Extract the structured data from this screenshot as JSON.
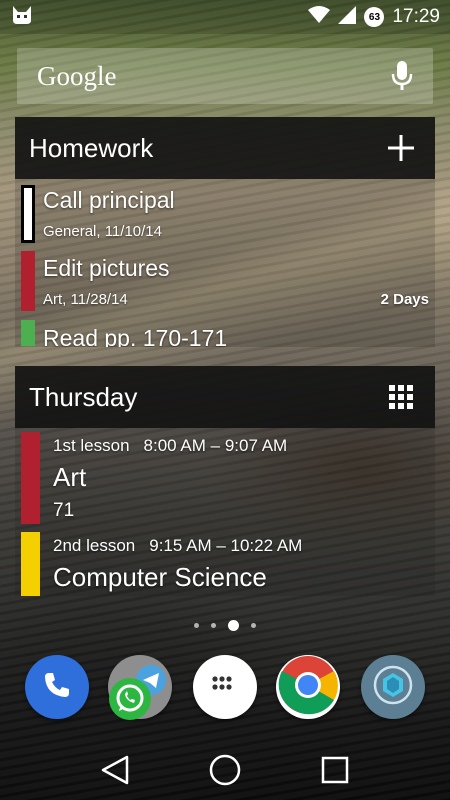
{
  "status_bar": {
    "time": "17:29",
    "battery_level": "63",
    "icons": [
      "cat-face-icon",
      "wifi-icon",
      "signal-icon",
      "battery-icon"
    ]
  },
  "search": {
    "logo_text": "Google",
    "icon": "mic-icon"
  },
  "homework": {
    "title": "Homework",
    "action_icon": "plus-icon",
    "items": [
      {
        "title": "Call principal",
        "subtitle": "General, 11/10/14",
        "due": "",
        "color": "#ffffff",
        "border": "#000000"
      },
      {
        "title": "Edit pictures",
        "subtitle": "Art, 11/28/14",
        "due": "2 Days",
        "color": "#b0202e"
      },
      {
        "title": "Read pp. 170-171",
        "subtitle": "",
        "due": "",
        "color": "#4caf50"
      }
    ]
  },
  "timetable": {
    "title": "Thursday",
    "action_icon": "grid-icon",
    "lessons": [
      {
        "lesson": "1st lesson",
        "time": "8:00 AM – 9:07 AM",
        "subject": "Art",
        "room": "71",
        "color": "#b0202e"
      },
      {
        "lesson": "2nd lesson",
        "time": "9:15 AM – 10:22 AM",
        "subject": "Computer Science",
        "room": "",
        "color": "#f5d000"
      }
    ]
  },
  "pager": {
    "pages": 4,
    "active_index": 2
  },
  "dock": [
    {
      "name": "phone",
      "icon": "phone-icon",
      "bg": "#2f6fdc"
    },
    {
      "name": "messaging-folder",
      "icon": "whatsapp-icon",
      "bg": "#9a9a9a"
    },
    {
      "name": "app-drawer",
      "icon": "app-drawer-icon",
      "bg": "#ffffff"
    },
    {
      "name": "chrome",
      "icon": "chrome-icon",
      "bg": "#ffffff"
    },
    {
      "name": "camera-app",
      "icon": "hexagon-icon",
      "bg": "#5d7f93"
    }
  ],
  "navigation": [
    "back-icon",
    "home-icon",
    "recents-icon"
  ]
}
